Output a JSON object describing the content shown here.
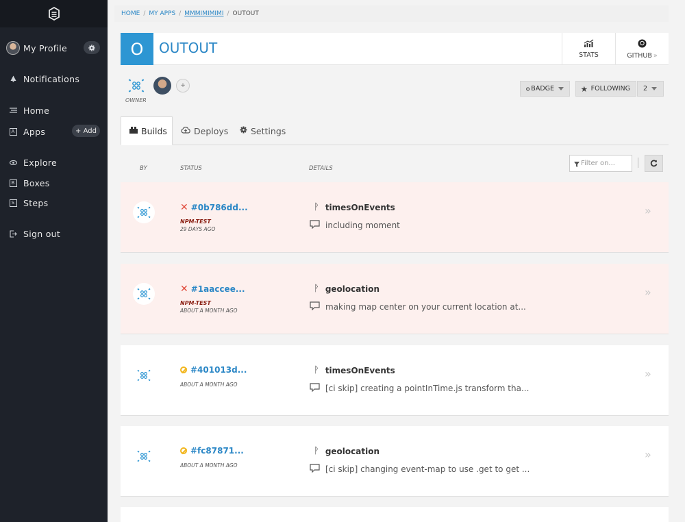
{
  "sidebar": {
    "profile_label": "My Profile",
    "items": [
      {
        "label": "Notifications",
        "icon": "bell-icon"
      },
      {
        "label": "Home",
        "icon": "home-lines-icon"
      },
      {
        "label": "Apps",
        "icon": "apps-box-icon",
        "icon_glyph": "A"
      },
      {
        "label": "Explore",
        "icon": "eye-icon"
      },
      {
        "label": "Boxes",
        "icon": "boxes-box-icon",
        "icon_glyph": "B"
      },
      {
        "label": "Steps",
        "icon": "steps-box-icon",
        "icon_glyph": "S"
      },
      {
        "label": "Sign out",
        "icon": "sign-out-icon"
      }
    ],
    "add_label": "+ Add"
  },
  "breadcrumb": {
    "home": "HOME",
    "my_apps": "MY APPS",
    "owner": "MMMIMIMIMI",
    "current": "OUTOUT",
    "sep": "/"
  },
  "app": {
    "letter": "O",
    "title": "OUTOUT",
    "stats_label": "STATS",
    "github_label": "GITHUB",
    "github_suffix": "»",
    "owner_label": "OWNER",
    "plus": "+",
    "badge_label": "BADGE",
    "following_label": "FOLLOWING",
    "following_count": "2"
  },
  "tabs": [
    {
      "label": "Builds",
      "icon": "builds-icon"
    },
    {
      "label": "Deploys",
      "icon": "cloud-upload-icon"
    },
    {
      "label": "Settings",
      "icon": "gear-icon"
    }
  ],
  "columns": {
    "by": "BY",
    "status": "STATUS",
    "details": "DETAILS"
  },
  "filter": {
    "placeholder": "Filter on..."
  },
  "builds": [
    {
      "id": "#0b786dd...",
      "status": "failed",
      "step": "NPM-TEST",
      "time": "29 DAYS AGO",
      "branch": "timesOnEvents",
      "message": "including moment"
    },
    {
      "id": "#1aaccee...",
      "status": "failed",
      "step": "NPM-TEST",
      "time": "ABOUT A MONTH AGO",
      "branch": "geolocation",
      "message": "making map center on your current location at..."
    },
    {
      "id": "#401013d...",
      "status": "skipped",
      "step": "",
      "time": "ABOUT A MONTH AGO",
      "branch": "timesOnEvents",
      "message": "[ci skip] creating a pointInTime.js transform tha..."
    },
    {
      "id": "#fc87871...",
      "status": "skipped",
      "step": "",
      "time": "ABOUT A MONTH AGO",
      "branch": "geolocation",
      "message": "[ci skip] changing event-map to use .get to get ..."
    }
  ],
  "colors": {
    "sidebar_bg": "#1e222a",
    "accent": "#2d96d3",
    "link": "#2b87c6",
    "failed_bg": "#fdf0ee",
    "failed_x": "#e04b3c",
    "skipped": "#f2b61d",
    "step_text": "#8a1e12"
  }
}
